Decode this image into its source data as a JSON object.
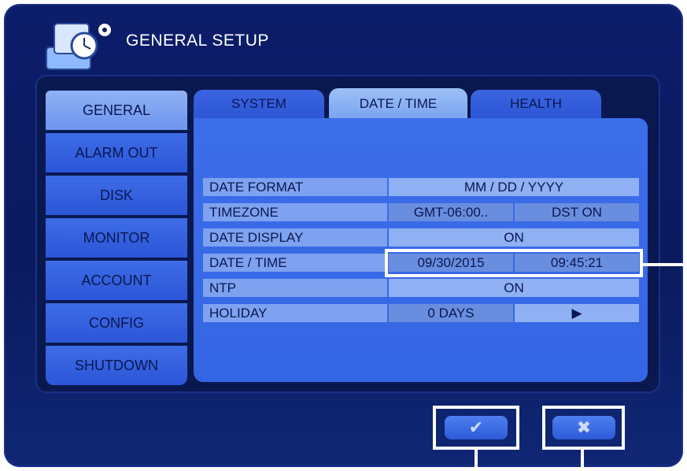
{
  "window": {
    "title": "GENERAL SETUP"
  },
  "sidebar": {
    "items": [
      {
        "label": "GENERAL"
      },
      {
        "label": "ALARM OUT"
      },
      {
        "label": "DISK"
      },
      {
        "label": "MONITOR"
      },
      {
        "label": "ACCOUNT"
      },
      {
        "label": "CONFIG"
      },
      {
        "label": "SHUTDOWN"
      }
    ],
    "active": "GENERAL"
  },
  "tabs": [
    {
      "label": "SYSTEM"
    },
    {
      "label": "DATE / TIME"
    },
    {
      "label": "HEALTH"
    }
  ],
  "active_tab": "DATE / TIME",
  "settings": {
    "date_format": {
      "label": "DATE FORMAT",
      "value": "MM / DD / YYYY"
    },
    "timezone": {
      "label": "TIMEZONE",
      "value": "GMT-06:00..",
      "dst": "DST ON"
    },
    "date_display": {
      "label": "DATE DISPLAY",
      "value": "ON"
    },
    "date_time": {
      "label": "DATE / TIME",
      "date": "09/30/2015",
      "time": "09:45:21"
    },
    "ntp": {
      "label": "NTP",
      "value": "ON"
    },
    "holiday": {
      "label": "HOLIDAY",
      "value": "0 DAYS",
      "arrow": "▶"
    }
  },
  "buttons": {
    "ok_icon": "✔",
    "cancel_icon": "✖"
  },
  "colors": {
    "background": "#0a1a5e",
    "accent": "#3d6eea",
    "highlight": "#ffffff"
  }
}
